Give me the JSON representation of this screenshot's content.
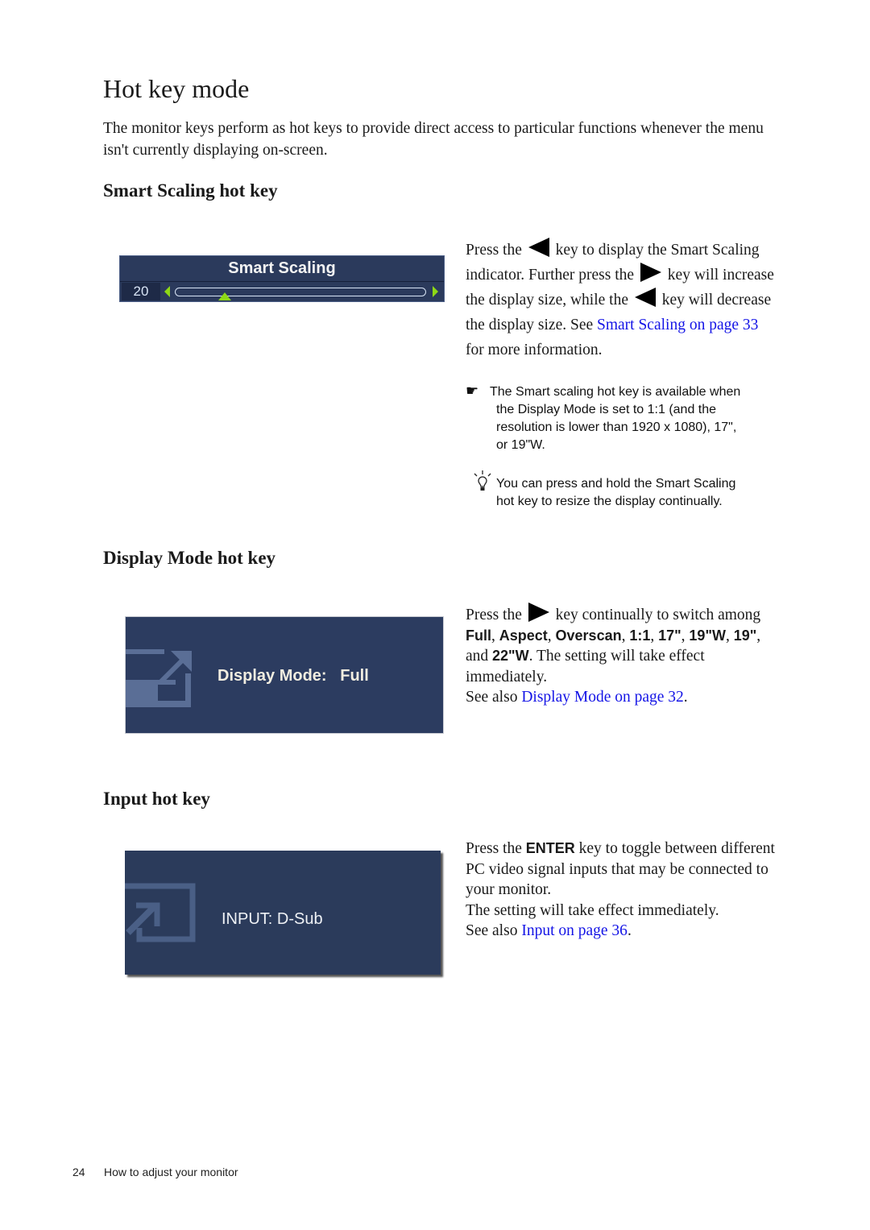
{
  "page": {
    "title": "Hot key mode",
    "intro": "The monitor keys perform as hot keys to provide direct access to particular functions whenever the menu isn't currently displaying on-screen."
  },
  "smart_scaling": {
    "heading": "Smart Scaling hot key",
    "osd": {
      "title": "Smart Scaling",
      "value": "20",
      "slider_fraction": 0.2,
      "accent_color": "#8ed816"
    },
    "text": {
      "p1": "Press the",
      "p2": "key to display the Smart Scaling indicator. Further press the",
      "p3": "key will increase the display size, while the",
      "p4": "key will decrease the display size. See",
      "link": "Smart Scaling on page 33",
      "p5": "for more information."
    },
    "note": {
      "icon": "pointing-hand-icon",
      "line1": "The Smart scaling hot key is available when",
      "line2": "the Display Mode is set to 1:1 (and the",
      "line3": "resolution is lower than 1920 x 1080), 17\",",
      "line4": "or 19\"W."
    },
    "tip": {
      "icon": "lightbulb-icon",
      "line1": "You can press and hold the Smart Scaling",
      "line2": "hot key to resize the display continually."
    }
  },
  "display_mode": {
    "heading": "Display Mode hot key",
    "osd": {
      "label": "Display Mode:",
      "value": "Full"
    },
    "text": {
      "p1": "Press the",
      "p2": "key continually to switch among",
      "opt1": "Full",
      "sep1": ",",
      "opt2": "Aspect",
      "sep2": ",",
      "opt3": "Overscan",
      "sep3": ",",
      "opt4": "1:1",
      "sep4": ",",
      "opt5": "17\"",
      "sep5": ",",
      "opt6": "19\"W",
      "sep6": ",",
      "opt7": "19\"",
      "sep7": ", and",
      "opt8": "22\"W",
      "p3": ". The setting will take effect immediately.",
      "see_also": "See also",
      "link": "Display Mode on page 32",
      "end": "."
    }
  },
  "input": {
    "heading": "Input hot key",
    "osd": {
      "label": "INPUT: D-Sub"
    },
    "text": {
      "p1": "Press the",
      "key": "ENTER",
      "p2": "key to toggle between different PC video signal inputs that may be connected to your monitor.",
      "p3": "The setting will take effect immediately.",
      "see_also": "See also",
      "link": "Input on page 36",
      "end": "."
    }
  },
  "footer": {
    "page_number": "24",
    "section": "How to adjust your monitor"
  },
  "colors": {
    "link": "#1414e6",
    "osd_bg": "#2b3a5c"
  }
}
